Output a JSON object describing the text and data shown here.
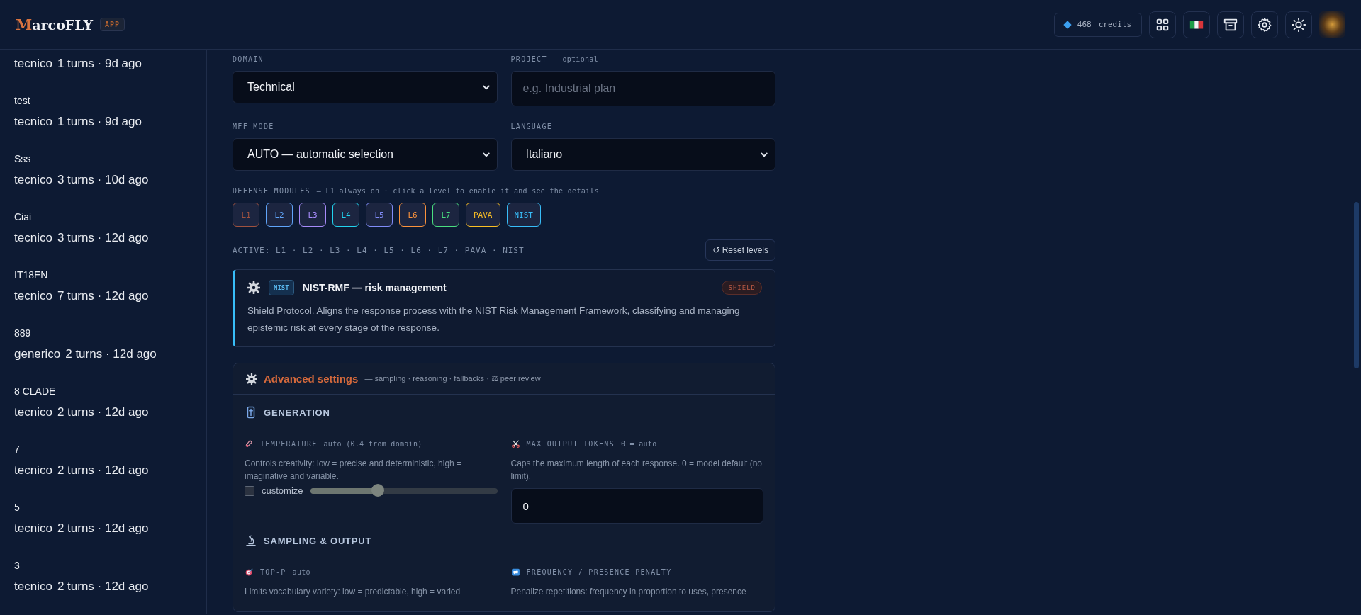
{
  "header": {
    "logo": "MarcoFLY",
    "badge": "APP",
    "credits": {
      "amount": "468",
      "label": "credits"
    }
  },
  "sidebar": {
    "sessions": [
      {
        "domain": "tecnico",
        "meta": "1 turns · 9d ago"
      },
      {
        "title": "test",
        "domain": "tecnico",
        "meta": "1 turns · 9d ago"
      },
      {
        "title": "Sss",
        "domain": "tecnico",
        "meta": "3 turns · 10d ago"
      },
      {
        "title": "Ciai",
        "domain": "tecnico",
        "meta": "3 turns · 12d ago"
      },
      {
        "title": "IT18EN",
        "domain": "tecnico",
        "meta": "7 turns · 12d ago"
      },
      {
        "title": "889",
        "domain": "generico",
        "meta": "2 turns · 12d ago"
      },
      {
        "title": "8 CLADE",
        "domain": "tecnico",
        "meta": "2 turns · 12d ago"
      },
      {
        "title": "7",
        "domain": "tecnico",
        "meta": "2 turns · 12d ago"
      },
      {
        "title": "5",
        "domain": "tecnico",
        "meta": "2 turns · 12d ago"
      },
      {
        "title": "3",
        "domain": "tecnico",
        "meta": "2 turns · 12d ago"
      }
    ]
  },
  "form": {
    "fields": [
      {
        "kind": "select",
        "label": "DOMAIN",
        "value": "Technical"
      },
      {
        "kind": "input",
        "label": "PROJECT",
        "hint": "— optional",
        "placeholder": "e.g. Industrial plan"
      },
      {
        "kind": "select",
        "label": "MFF MODE",
        "value": "AUTO — automatic selection"
      },
      {
        "kind": "select",
        "label": "LANGUAGE",
        "value": "Italiano"
      }
    ]
  },
  "defense": {
    "label": "DEFENSE MODULES",
    "hint": "— L1 always on · click a level to enable it and see the details",
    "modules": [
      {
        "label": "L1",
        "color": "#a0523f"
      },
      {
        "label": "L2",
        "color": "#60a5fa"
      },
      {
        "label": "L3",
        "color": "#a78bfa"
      },
      {
        "label": "L4",
        "color": "#22d3ee"
      },
      {
        "label": "L5",
        "color": "#818cf8"
      },
      {
        "label": "L6",
        "color": "#fb923c"
      },
      {
        "label": "L7",
        "color": "#4ade80"
      },
      {
        "label": "PAVA",
        "color": "#fbbf24"
      },
      {
        "label": "NIST",
        "color": "#38bdf8"
      }
    ],
    "active": "ACTIVE: L1 · L2 · L3 · L4 · L5 · L6 · L7 · PAVA · NIST",
    "reset_button": "↺ Reset levels"
  },
  "detail_card": {
    "tag": "NIST",
    "title": "NIST-RMF — risk management",
    "badge": "SHIELD",
    "text": "Shield Protocol. Aligns the response process with the NIST Risk Management Framework, classifying and managing epistemic risk at every stage of the response."
  },
  "advanced": {
    "title": "Advanced settings",
    "subtitle": "— sampling · reasoning · fallbacks · ⚖ peer review",
    "sections": [
      {
        "title": "GENERATION",
        "params": [
          {
            "kind": "slider",
            "label": "TEMPERATURE",
            "hint": "auto (0.4 from domain)",
            "description": "Controls creativity: low = precise and deterministic, high = imaginative and variable.",
            "checkbox_label": "customize",
            "checked": false,
            "level": 0.36
          },
          {
            "kind": "number",
            "label": "MAX OUTPUT TOKENS",
            "hint": "0 = auto",
            "description": "Caps the maximum length of each response. 0 = model default (no limit).",
            "value": "0"
          }
        ]
      },
      {
        "title": "SAMPLING & OUTPUT",
        "params": [
          {
            "kind": "text",
            "label": "TOP-P",
            "hint": "auto",
            "description": "Limits vocabulary variety: low = predictable, high = varied"
          },
          {
            "kind": "text",
            "label": "FREQUENCY / PRESENCE PENALTY",
            "description": "Penalize repetitions: frequency in proportion to uses, presence"
          }
        ]
      }
    ]
  }
}
